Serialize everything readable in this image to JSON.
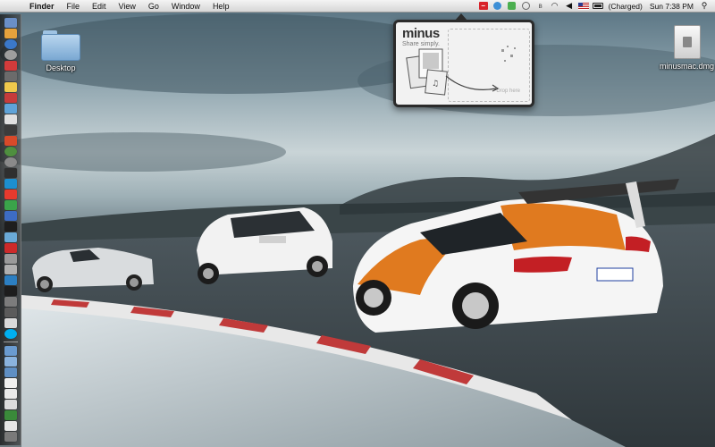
{
  "menubar": {
    "app_name": "Finder",
    "menus": [
      "File",
      "Edit",
      "View",
      "Go",
      "Window",
      "Help"
    ],
    "battery_status": "(Charged)",
    "clock": "Sun 7:38 PM",
    "icons": [
      "apple-icon",
      "minus-menu-icon",
      "sync-icon",
      "evernote-icon",
      "time-machine-icon",
      "bluetooth-icon",
      "wifi-icon",
      "volume-icon",
      "flag-icon",
      "battery-icon",
      "spotlight-icon"
    ]
  },
  "desktop": {
    "icons": [
      {
        "label": "Desktop",
        "kind": "folder"
      },
      {
        "label": "minusmac.dmg",
        "kind": "disk-image"
      }
    ]
  },
  "minus_popup": {
    "logo": "minus",
    "tagline": "Share simply.",
    "drop_hint": "Drop here"
  },
  "colors": {
    "minus_red": "#d8232a",
    "menubar_top": "#f4f4f4"
  }
}
